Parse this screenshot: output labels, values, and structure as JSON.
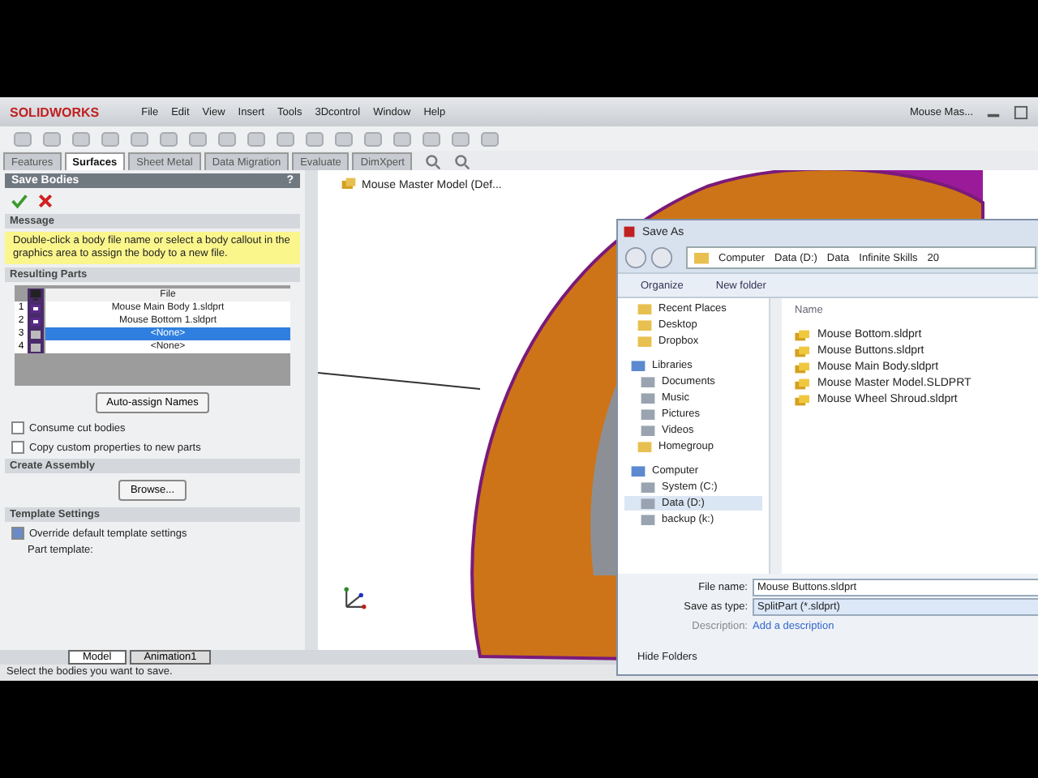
{
  "app": {
    "logo": "SOLIDWORKS",
    "menu": [
      "File",
      "Edit",
      "View",
      "Insert",
      "Tools",
      "3Dcontrol",
      "Window",
      "Help"
    ],
    "document_title": "Mouse Mas..."
  },
  "command_tabs": [
    {
      "label": "Features",
      "selected": false
    },
    {
      "label": "Surfaces",
      "selected": true
    },
    {
      "label": "Sheet Metal",
      "selected": false
    },
    {
      "label": "Data Migration",
      "selected": false
    },
    {
      "label": "Evaluate",
      "selected": false
    },
    {
      "label": "DimXpert",
      "selected": false
    }
  ],
  "feature_tree": {
    "root": "Mouse Master Model  (Def..."
  },
  "property_manager": {
    "title": "Save Bodies",
    "help": "?",
    "message": {
      "title": "Message",
      "text": "Double-click a body file name or select a body callout in the graphics area to assign the body to a new file."
    },
    "resulting_parts": {
      "title": "Resulting Parts",
      "column": "File",
      "rows": [
        {
          "index": "1",
          "checked": true,
          "file": "Mouse Main Body 1.sldprt",
          "selected": false
        },
        {
          "index": "2",
          "checked": true,
          "file": "Mouse Bottom 1.sldprt",
          "selected": false
        },
        {
          "index": "3",
          "checked": false,
          "file": "<None>",
          "selected": true
        },
        {
          "index": "4",
          "checked": false,
          "file": "<None>",
          "selected": false
        }
      ]
    },
    "auto_assign_button": "Auto-assign Names",
    "options": [
      {
        "label": "Consume cut bodies",
        "checked": false
      },
      {
        "label": "Copy custom properties to new parts",
        "checked": false
      }
    ],
    "create_assembly": {
      "title": "Create Assembly",
      "browse_button": "Browse..."
    },
    "template_settings": {
      "title": "Template Settings",
      "override": {
        "label": "Override default template settings",
        "checked": true
      },
      "part_template_label": "Part template:"
    }
  },
  "bottom_tabs": [
    {
      "label": "Model",
      "selected": true
    },
    {
      "label": "Animation1",
      "selected": false
    }
  ],
  "status_bar": "Select the bodies you want to save.",
  "save_as": {
    "title": "Save As",
    "breadcrumb": [
      "Computer",
      "Data (D:)",
      "Data",
      "Infinite Skills",
      "20"
    ],
    "toolbar": [
      "Organize",
      "New folder"
    ],
    "nav": [
      {
        "label": "Recent Places",
        "selected": false
      },
      {
        "label": "Desktop",
        "selected": false
      },
      {
        "label": "Dropbox",
        "selected": false
      },
      {
        "label": "Libraries",
        "selected": false,
        "children": [
          {
            "label": "Documents",
            "selected": false
          },
          {
            "label": "Music",
            "selected": false
          },
          {
            "label": "Pictures",
            "selected": false
          },
          {
            "label": "Videos",
            "selected": false
          }
        ]
      },
      {
        "label": "Homegroup",
        "selected": false
      },
      {
        "label": "Computer",
        "selected": false,
        "children": [
          {
            "label": "System (C:)",
            "selected": false
          },
          {
            "label": "Data (D:)",
            "selected": true
          },
          {
            "label": "backup (k:)",
            "selected": false
          }
        ]
      }
    ],
    "column": "Name",
    "files": [
      "Mouse Bottom.sldprt",
      "Mouse Buttons.sldprt",
      "Mouse Main Body.sldprt",
      "Mouse Master Model.SLDPRT",
      "Mouse Wheel Shroud.sldprt"
    ],
    "file_name_label": "File name:",
    "file_name": "Mouse Buttons.sldprt",
    "save_as_type_label": "Save as type:",
    "save_as_type": "SplitPart (*.sldprt)",
    "description_label": "Description:",
    "description_link": "Add a description",
    "hide_folders": "Hide Folders"
  }
}
